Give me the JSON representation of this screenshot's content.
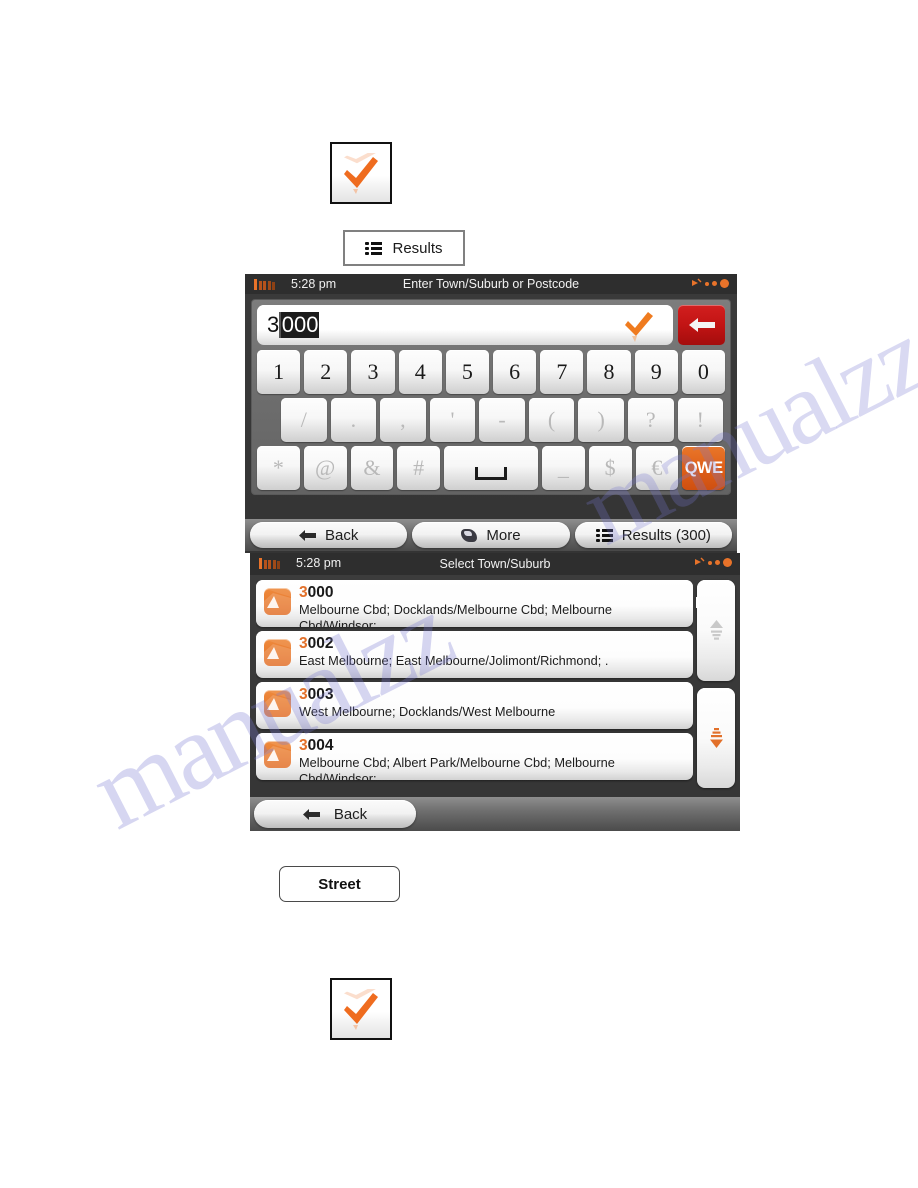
{
  "doc": {
    "check_button_label": "check-mark",
    "results_button_label": "Results",
    "street_button_label": "Street",
    "watermark_top": "manualzz.com",
    "watermark_bottom": "manualzz"
  },
  "screen1": {
    "statusbar": {
      "time": "5:28 pm",
      "title": "Enter Town/Suburb or Postcode",
      "battery_icon": "battery-icon",
      "gps_icon": "satellite-icon"
    },
    "input": {
      "value": "3000",
      "typed": "3",
      "suggested": "000",
      "accept_icon": "check-icon",
      "backspace_icon": "backspace-arrow-icon"
    },
    "keyboard": {
      "row1": [
        "1",
        "2",
        "3",
        "4",
        "5",
        "6",
        "7",
        "8",
        "9",
        "0"
      ],
      "row2": [
        "/",
        ".",
        ",",
        "'",
        "-",
        "(",
        ")",
        "?",
        "!"
      ],
      "row3": [
        "*",
        "@",
        "&",
        "#",
        " ",
        "_",
        "$",
        "€",
        "QWE"
      ],
      "space_label": "space-key",
      "layout_switch_label": "QWE"
    },
    "bottombar": {
      "back_label": "Back",
      "more_label": "More",
      "results_label": "Results (300)"
    }
  },
  "screen2": {
    "statusbar": {
      "time": "5:28 pm",
      "title": "Select Town/Suburb",
      "battery_icon": "battery-icon",
      "gps_icon": "satellite-icon"
    },
    "list": [
      {
        "code_highlight": "3",
        "code_rest": "000",
        "description": "Melbourne Cbd; Docklands/Melbourne Cbd; Melbourne Cbd/Windsor;"
      },
      {
        "code_highlight": "3",
        "code_rest": "002",
        "description": "East Melbourne; East Melbourne/Jolimont/Richmond; ."
      },
      {
        "code_highlight": "3",
        "code_rest": "003",
        "description": "West Melbourne; Docklands/West Melbourne"
      },
      {
        "code_highlight": "3",
        "code_rest": "004",
        "description": "Melbourne Cbd; Albert Park/Melbourne Cbd; Melbourne Cbd/Windsor;"
      }
    ],
    "scroll": {
      "up_label": "scroll-up",
      "down_label": "scroll-down"
    },
    "bottombar": {
      "back_label": "Back"
    }
  },
  "colors": {
    "accent_orange": "#e2702a",
    "backspace_red": "#c21414",
    "status_bg": "#2e2e2e"
  }
}
